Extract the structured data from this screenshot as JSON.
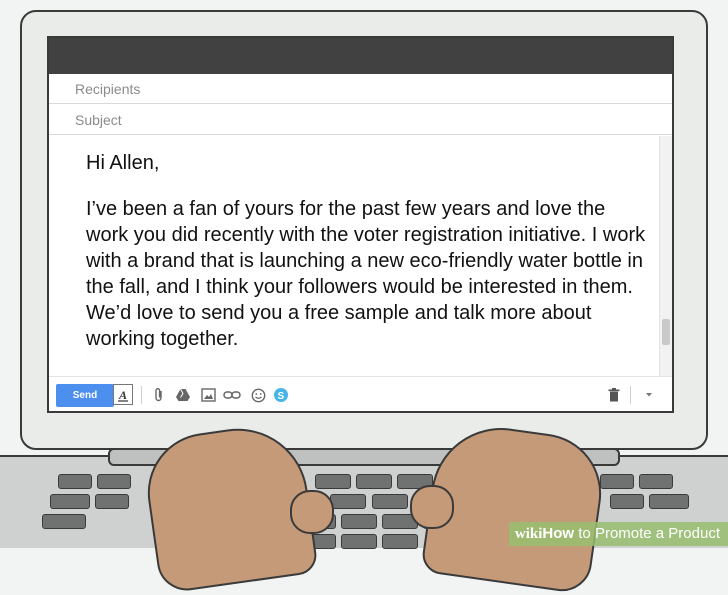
{
  "compose": {
    "recipients_placeholder": "Recipients",
    "subject_placeholder": "Subject",
    "greeting": "Hi Allen,",
    "message": "I’ve been a fan of yours for the past few years and love the work you did recently with the voter registration initiative. I work with a brand that is launching a new eco-friendly water bottle in the fall, and I think your followers would be interested in them. We’d love to send you a free sample and talk more about working together."
  },
  "toolbar": {
    "send_label": "Send",
    "icons": [
      "format-text-icon",
      "attach-icon",
      "drive-icon",
      "photo-icon",
      "link-icon",
      "emoji-icon",
      "skype-icon",
      "trash-icon",
      "more-options-icon"
    ]
  },
  "watermark": {
    "brand": "wiki",
    "how": "How",
    "rest": " to Promote a Product"
  },
  "colors": {
    "send_button": "#4d8fef",
    "titlebar": "#414141",
    "watermark_bg": "#96be6e",
    "skin": "#c59a78"
  }
}
